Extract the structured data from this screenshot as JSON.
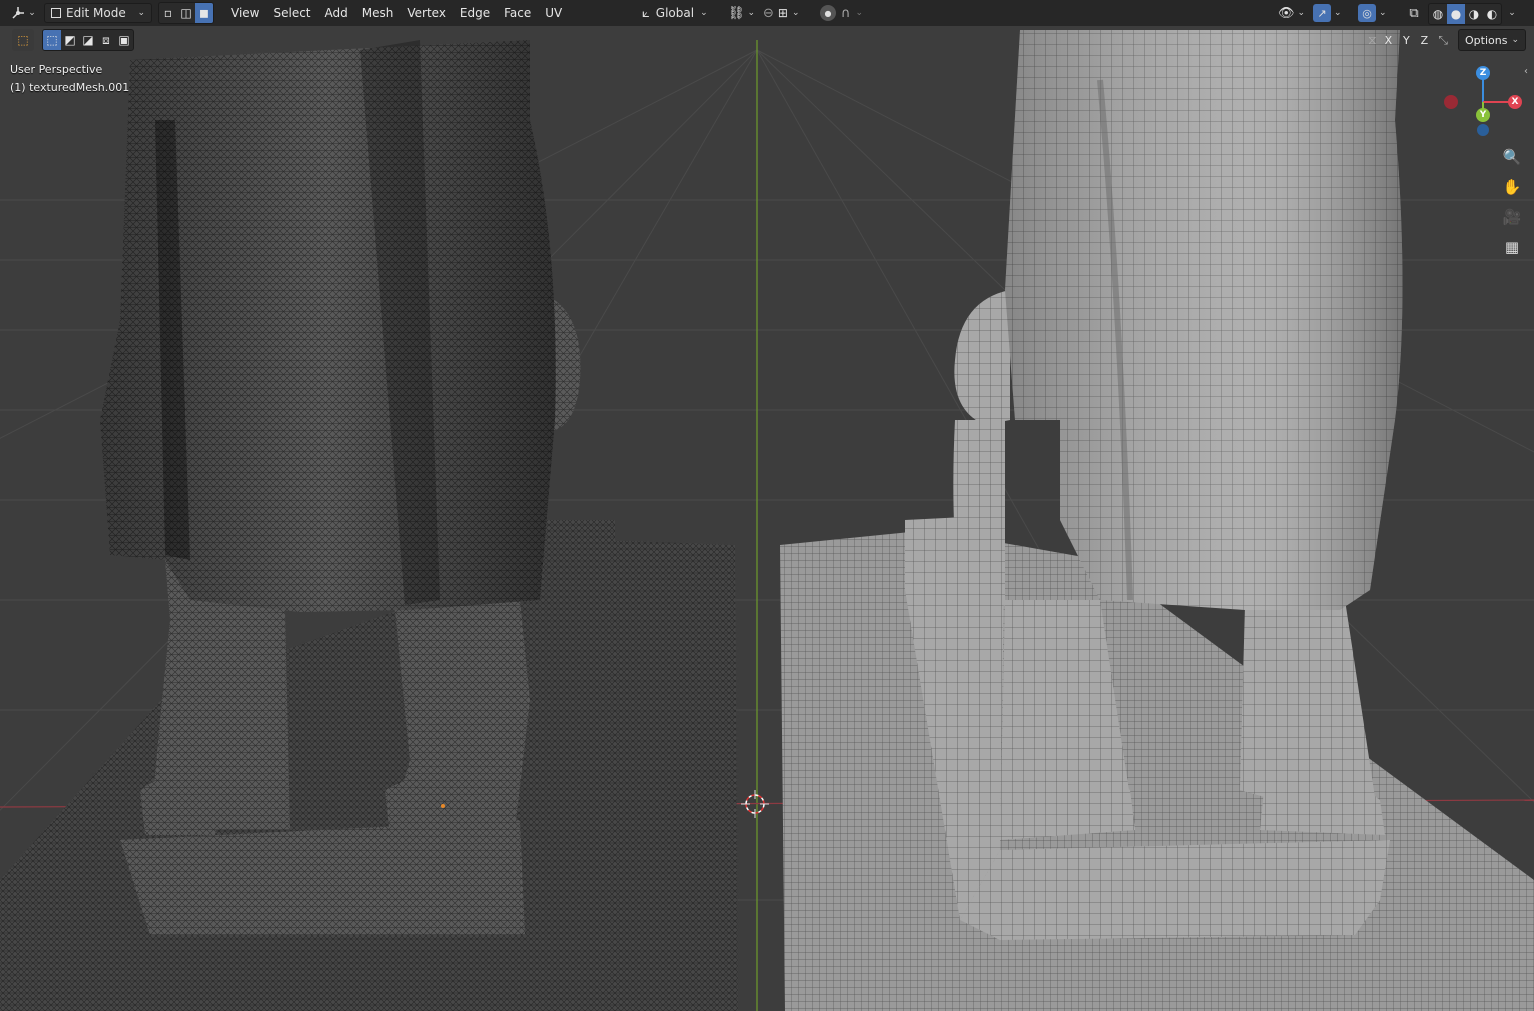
{
  "header": {
    "editor_type_icon": "axis-gizmo-icon",
    "mode": "Edit Mode",
    "menus": [
      "View",
      "Select",
      "Add",
      "Mesh",
      "Vertex",
      "Edge",
      "Face",
      "UV"
    ],
    "transform_orientation": "Global"
  },
  "toolbar": {
    "options_label": "Options",
    "mirror_axes": [
      "X",
      "Y",
      "Z"
    ]
  },
  "viewport": {
    "view_name": "User Perspective",
    "object_name": "(1) texturedMesh.001"
  },
  "gizmo": {
    "x": "X",
    "y": "Y",
    "z": "Z"
  },
  "colors": {
    "accent": "#4772b3",
    "axis_x": "#e04452",
    "axis_y": "#8ac23a",
    "axis_z": "#3b8ee0"
  }
}
